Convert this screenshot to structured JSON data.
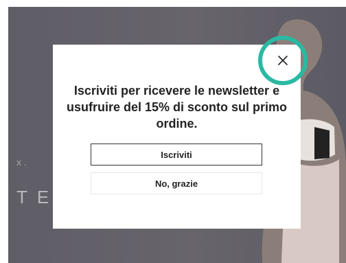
{
  "background": {
    "subtext": "x.",
    "big_text": "TE"
  },
  "modal": {
    "title": "Iscriviti per ricevere le newsletter e usufruire del 15% di sconto sul primo ordine.",
    "subscribe_label": "Iscriviti",
    "decline_label": "No, grazie",
    "close_icon": "close-icon"
  },
  "colors": {
    "highlight_ring": "#2ab9a2",
    "overlay": "#65636b"
  }
}
